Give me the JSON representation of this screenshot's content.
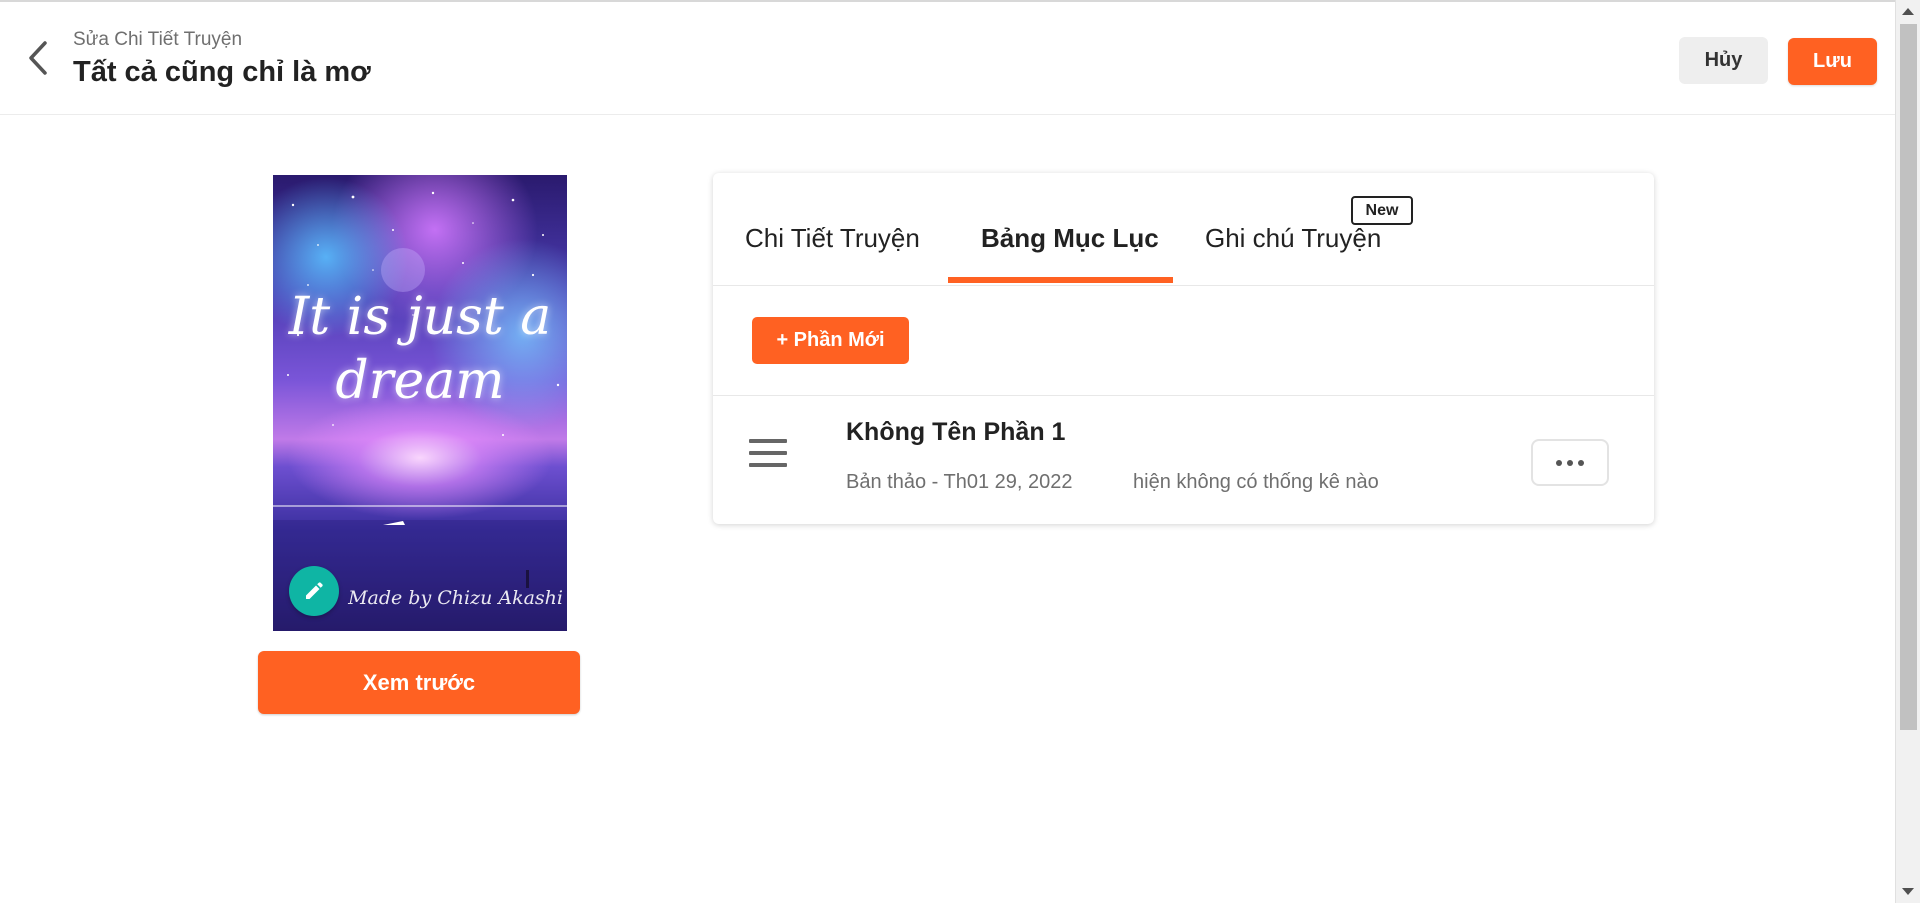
{
  "header": {
    "subtitle": "Sửa Chi Tiết Truyện",
    "title": "Tất cả cũng chỉ là mơ",
    "cancel_label": "Hủy",
    "save_label": "Lưu"
  },
  "cover": {
    "art_text": "It is just a\ndream",
    "credit": "Made by Chizu Akashi",
    "preview_label": "Xem trước"
  },
  "tabs": [
    {
      "label": "Chi Tiết Truyện",
      "active": false
    },
    {
      "label": "Bảng Mục Lục",
      "active": true
    },
    {
      "label": "Ghi chú Truyện",
      "active": false,
      "badge": "New"
    }
  ],
  "toc": {
    "new_part_label": "+ Phần Mới",
    "parts": [
      {
        "title": "Không Tên Phần 1",
        "status": "Bản thảo - Th01 29, 2022",
        "stats": "hiện không có thống kê nào"
      }
    ]
  },
  "colors": {
    "accent": "#ff6122",
    "edit_button": "#0fb5a4"
  },
  "icons": {
    "back": "chevron-left-icon",
    "edit": "pencil-icon",
    "drag": "drag-handle-icon",
    "more": "more-horizontal-icon"
  }
}
